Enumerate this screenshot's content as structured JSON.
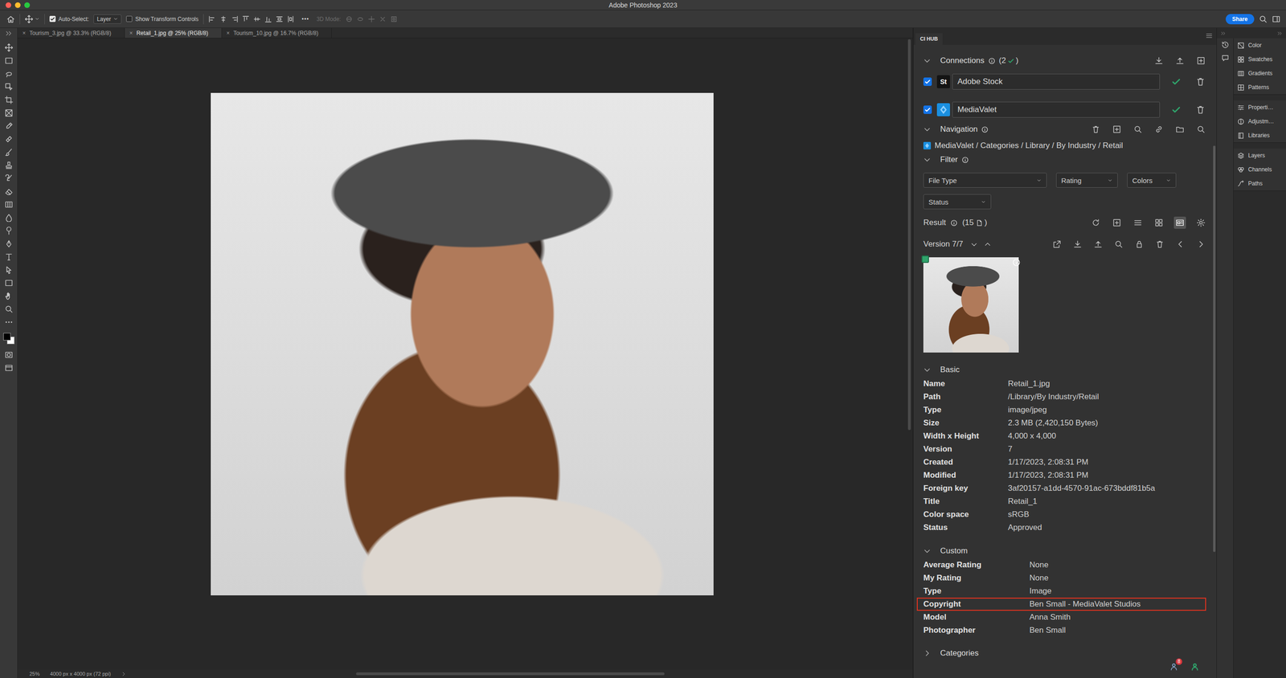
{
  "window": {
    "title": "Adobe Photoshop 2023"
  },
  "options_bar": {
    "auto_select": {
      "label": "Auto-Select:",
      "checked": true
    },
    "target": "Layer",
    "transform_controls": {
      "label": "Show Transform Controls",
      "checked": false
    },
    "more": "•••",
    "mode_3d": {
      "label": "3D Mode:",
      "disabled": true
    },
    "share": "Share"
  },
  "doc_tabs": [
    {
      "label": "Tourism_3.jpg @ 33.3% (RGB/8)",
      "close": "×",
      "selected": false
    },
    {
      "label": "Retail_1.jpg @ 25% (RGB/8)",
      "close": "×",
      "selected": true
    },
    {
      "label": "Tourism_10.jpg @ 16.7% (RGB/8)",
      "close": "×",
      "selected": false
    }
  ],
  "status_bar": {
    "zoom": "25%",
    "info": "4000 px x 4000 px (72 ppi)"
  },
  "ci_hub": {
    "tab": "CI HUB",
    "connections": {
      "title": "Connections",
      "expanded": true,
      "count": "(2",
      "count_end": ")",
      "items": [
        {
          "name": "Adobe Stock",
          "kind": "adobe-stock",
          "logo": "St",
          "checked": true,
          "connected": true
        },
        {
          "name": "MediaValet",
          "kind": "mediavalet",
          "checked": true,
          "connected": true
        }
      ]
    },
    "navigation": {
      "title": "Navigation",
      "expanded": true,
      "breadcrumb": "MediaValet / Categories / Library / By Industry / Retail"
    },
    "filter": {
      "title": "Filter",
      "expanded": true,
      "rows": [
        [
          "File Type",
          "Rating",
          "Colors"
        ],
        [
          "Status"
        ]
      ]
    },
    "result": {
      "title": "Result",
      "count": "(15",
      "count_end": ")",
      "views": [
        {
          "kind": "list",
          "selected": false
        },
        {
          "kind": "grid",
          "selected": false
        },
        {
          "kind": "detail",
          "selected": true
        }
      ]
    },
    "version": {
      "label": "Version 7/7"
    },
    "basic": {
      "title": "Basic",
      "expanded": true,
      "rows": [
        {
          "key": "Name",
          "value": "Retail_1.jpg"
        },
        {
          "key": "Path",
          "value": "/Library/By Industry/Retail"
        },
        {
          "key": "Type",
          "value": "image/jpeg"
        },
        {
          "key": "Size",
          "value": "2.3 MB (2,420,150 Bytes)"
        },
        {
          "key": "Width x Height",
          "value": "4,000 x 4,000"
        },
        {
          "key": "Version",
          "value": "7"
        },
        {
          "key": "Created",
          "value": "1/17/2023, 2:08:31 PM"
        },
        {
          "key": "Modified",
          "value": "1/17/2023, 2:08:31 PM"
        },
        {
          "key": "Foreign key",
          "value": "3af20157-a1dd-4570-91ac-673bddf81b5a"
        },
        {
          "key": "Title",
          "value": "Retail_1"
        },
        {
          "key": "Color space",
          "value": "sRGB"
        },
        {
          "key": "Status",
          "value": "Approved"
        }
      ]
    },
    "custom": {
      "title": "Custom",
      "expanded": true,
      "rows": [
        {
          "key": "Average Rating",
          "value": "None",
          "highlighted": false
        },
        {
          "key": "My Rating",
          "value": "None",
          "highlighted": false
        },
        {
          "key": "Type",
          "value": "Image",
          "highlighted": false
        },
        {
          "key": "Copyright",
          "value": "Ben Small - MediaValet Studios",
          "highlighted": true
        },
        {
          "key": "Model",
          "value": "Anna Smith",
          "highlighted": false
        },
        {
          "key": "Photographer",
          "value": "Ben Small",
          "highlighted": false
        }
      ]
    },
    "categories": {
      "title": "Categories",
      "expanded": false
    },
    "notifications": {
      "count": "8"
    }
  },
  "dock": [
    {
      "items": [
        "Color",
        "Swatches",
        "Gradients",
        "Patterns"
      ]
    },
    {
      "items": [
        "Properti…",
        "Adjustm…",
        "Libraries"
      ]
    },
    {
      "items": [
        "Layers",
        "Channels",
        "Paths"
      ]
    }
  ]
}
